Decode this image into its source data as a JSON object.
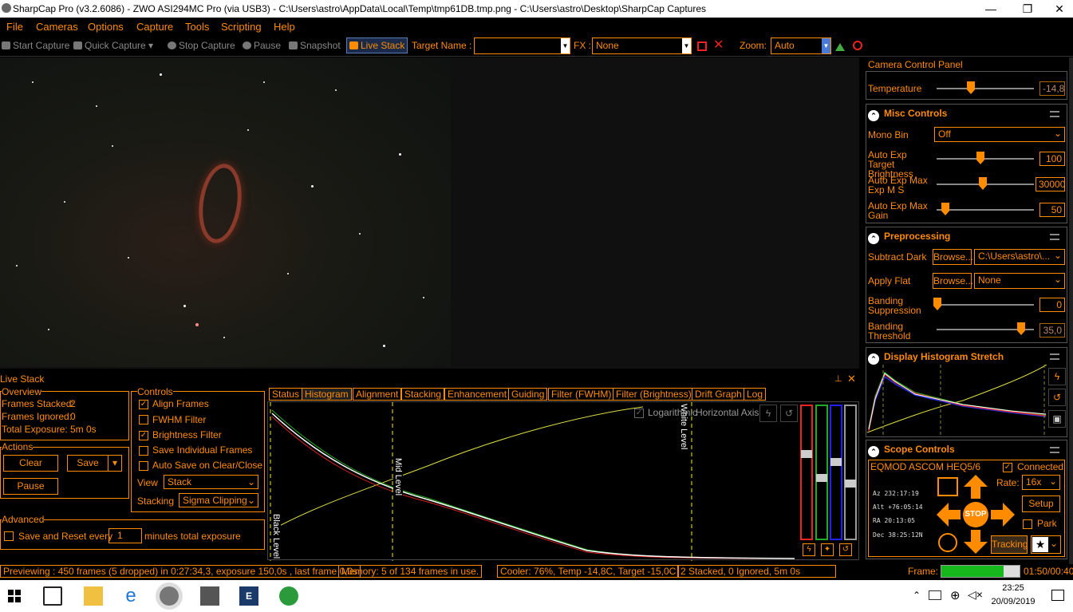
{
  "window": {
    "title": "SharpCap Pro (v3.2.6086) - ZWO ASI294MC Pro (via USB3) - C:\\Users\\astro\\AppData\\Local\\Temp\\tmp61DB.tmp.png - C:\\Users\\astro\\Desktop\\SharpCap Captures",
    "minimize": "—",
    "maximize": "❐",
    "close": "✕"
  },
  "menu": [
    "File",
    "Cameras",
    "Options",
    "Capture",
    "Tools",
    "Scripting",
    "Help"
  ],
  "toolbar": {
    "start_capture": "Start Capture",
    "quick_capture": "Quick Capture",
    "stop_capture": "Stop Capture",
    "pause": "Pause",
    "snapshot": "Snapshot",
    "live_stack": "Live Stack",
    "target_name_label": "Target Name :",
    "target_name_value": "",
    "fx_label": "FX :",
    "fx_value": "None",
    "zoom_label": "Zoom:",
    "zoom_value": "Auto"
  },
  "live_stack": {
    "title": "Live Stack",
    "overview": {
      "title": "Overview",
      "frames_stacked_label": "Frames Stacked:",
      "frames_stacked": "2",
      "frames_ignored_label": "Frames Ignored:",
      "frames_ignored": "0",
      "total_exposure_label": "Total Exposure:",
      "total_exposure": "5m 0s"
    },
    "actions": {
      "title": "Actions",
      "clear": "Clear",
      "save": "Save",
      "pause": "Pause"
    },
    "advanced": {
      "title": "Advanced",
      "save_reset_label": "Save and Reset every",
      "save_reset_value": "1",
      "minutes_label": "minutes total exposure"
    },
    "controls": {
      "title": "Controls",
      "align_frames": "Align Frames",
      "fwhm_filter": "FWHM Filter",
      "brightness_filter": "Brightness Filter",
      "save_individual": "Save Individual Frames",
      "auto_save": "Auto Save on Clear/Close",
      "view_label": "View",
      "view_value": "Stack",
      "stacking_label": "Stacking",
      "stacking_value": "Sigma Clipping",
      "align_checked": true,
      "fwhm_checked": false,
      "brightness_checked": true,
      "save_individual_checked": false,
      "auto_save_checked": false
    },
    "tabs": [
      "Status",
      "Histogram",
      "Alignment",
      "Stacking",
      "Enhancement",
      "Guiding",
      "Filter (FWHM)",
      "Filter (Brightness)",
      "Drift Graph",
      "Log"
    ],
    "active_tab": "Histogram",
    "histogram": {
      "logarithmic_label": "Logarithmic",
      "horizontal_axis_label": "Horizontal Axis",
      "black_level": "Black Level",
      "mid_level": "Mid Level",
      "white_level": "White Level"
    }
  },
  "camera_panel": {
    "title": "Camera Control Panel",
    "temperature_label": "Temperature",
    "temperature_value": "-14,8",
    "misc": {
      "title": "Misc Controls",
      "mono_bin_label": "Mono Bin",
      "mono_bin_value": "Off",
      "auto_exp_target_label": "Auto Exp Target Brightness",
      "auto_exp_target_value": "100",
      "auto_exp_max_label": "Auto Exp Max Exp M S",
      "auto_exp_max_value": "30000",
      "auto_exp_gain_label": "Auto Exp Max Gain",
      "auto_exp_gain_value": "50"
    },
    "preprocessing": {
      "title": "Preprocessing",
      "subtract_dark_label": "Subtract Dark",
      "browse": "Browse...",
      "subtract_dark_value": "C:\\Users\\astro\\...",
      "apply_flat_label": "Apply Flat",
      "apply_flat_value": "None",
      "banding_suppression_label": "Banding Suppression",
      "banding_suppression_value": "0",
      "banding_threshold_label": "Banding Threshold",
      "banding_threshold_value": "35,0"
    },
    "histogram_stretch": {
      "title": "Display Histogram Stretch"
    },
    "scope": {
      "title": "Scope Controls",
      "mount": "EQMOD ASCOM HEQ5/6",
      "connected_label": "Connected",
      "az": "Az  232:17:19",
      "alt": "Alt +76:05:14",
      "ra": "RA  20:13:05",
      "dec": "Dec 38:25:12N",
      "rate_label": "Rate:",
      "rate_value": "16x",
      "setup": "Setup",
      "park": "Park",
      "stop": "STOP",
      "tracking": "Tracking"
    }
  },
  "status": {
    "previewing": "Previewing : 450 frames (5 dropped) in 0:27:34,3, exposure 150,0s , last frame 0,0s",
    "memory": "Memory: 5 of 134 frames in use.",
    "cooler": "Cooler: 76%, Temp -14,8C, Target -15,0C",
    "stacked": "2 Stacked, 0 Ignored, 5m 0s",
    "frame_label": "Frame:",
    "frame_time": "01:50/00:40",
    "frame_progress": 0.8
  },
  "taskbar": {
    "time": "23:25",
    "date": "20/09/2019"
  },
  "colors": {
    "accent": "#ff8c00",
    "background": "#000000"
  }
}
